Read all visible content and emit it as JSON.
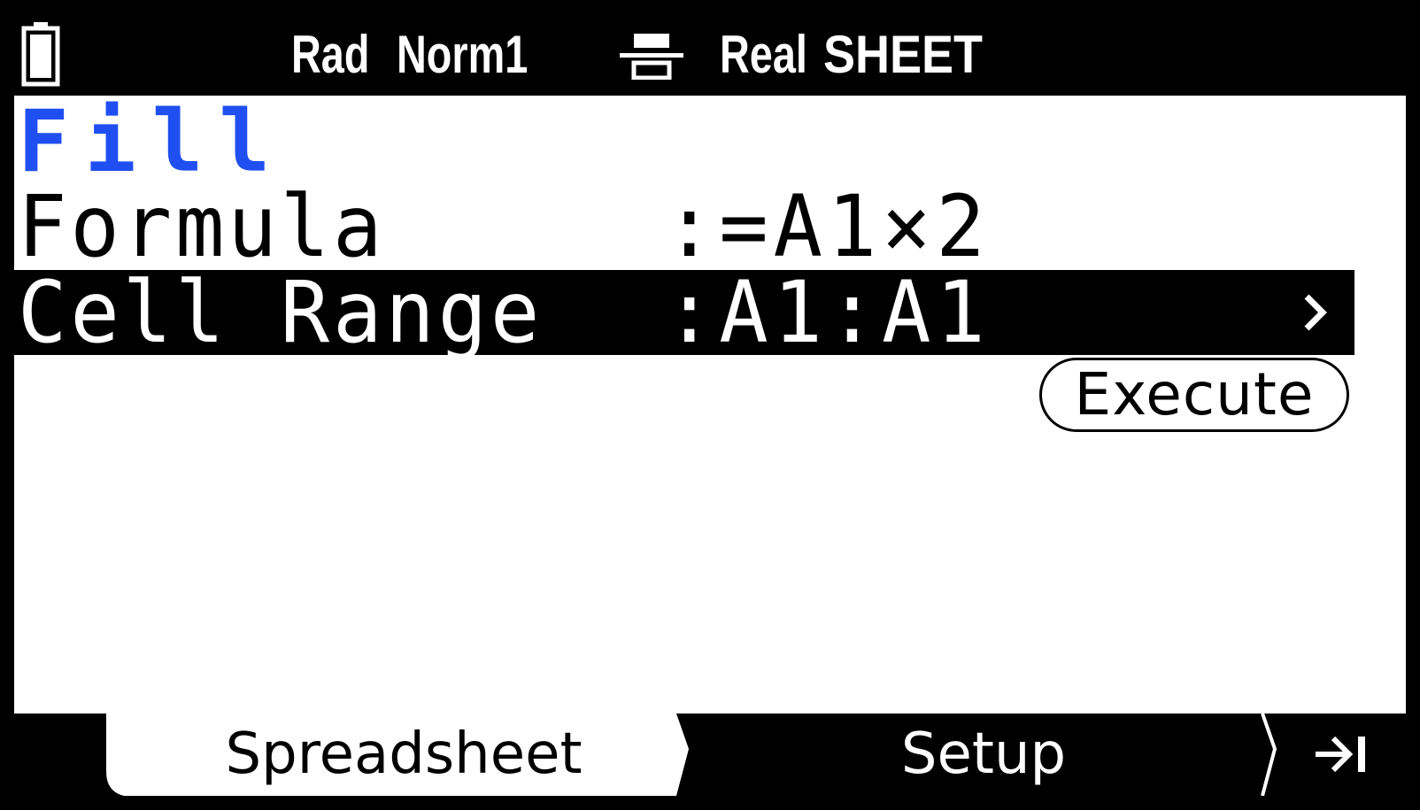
{
  "status_bar": {
    "battery_icon": "battery-icon",
    "angle_mode": "Rad",
    "display_mode": "Norm1",
    "fraction_icon": "fraction-format-icon",
    "complex_mode": "Real",
    "app_name": "SHEET"
  },
  "fill": {
    "title": "Fill",
    "formula_label": "Formula",
    "formula_value": ":=A1×2",
    "range_label": "Cell Range",
    "range_value": ":A1:A1",
    "range_chevron_icon": "chevron-right-icon",
    "execute_label": "Execute"
  },
  "function_bar": {
    "tabs": [
      {
        "label": "Spreadsheet",
        "selected": true
      },
      {
        "label": "Setup",
        "selected": false
      }
    ],
    "next_icon": "next-page-icon"
  },
  "colors": {
    "title_blue": "#1f4ff0",
    "foreground": "#000000",
    "background": "#ffffff"
  }
}
